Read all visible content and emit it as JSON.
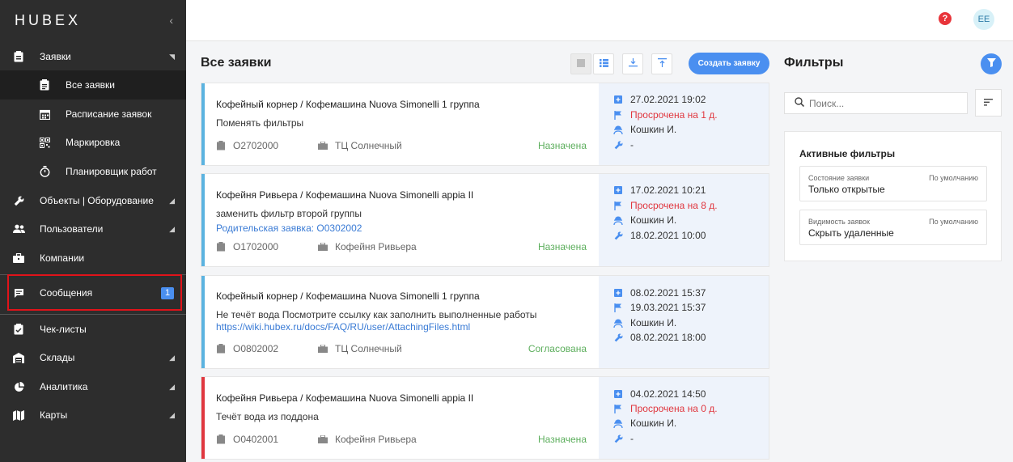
{
  "app": {
    "logo": "HUBEX",
    "collapse_icon": "chevron-left-icon"
  },
  "sidebar": {
    "items": [
      {
        "label": "Заявки",
        "icon": "clipboard-icon",
        "arrow": "◥"
      },
      {
        "label": "Все заявки",
        "icon": "list-clipboard-icon",
        "active": true
      },
      {
        "label": "Расписание заявок",
        "icon": "calendar-icon"
      },
      {
        "label": "Маркировка",
        "icon": "qr-code-icon"
      },
      {
        "label": "Планировщик работ",
        "icon": "stopwatch-icon"
      },
      {
        "label": "Объекты | Оборудование",
        "icon": "wrench-icon",
        "arrow": "◢"
      },
      {
        "label": "Пользователи",
        "icon": "users-icon",
        "arrow": "◢"
      },
      {
        "label": "Компании",
        "icon": "briefcase-icon"
      },
      {
        "label": "Сообщения",
        "icon": "message-icon",
        "badge": "1"
      },
      {
        "label": "Чек-листы",
        "icon": "checklist-icon"
      },
      {
        "label": "Склады",
        "icon": "warehouse-icon",
        "arrow": "◢"
      },
      {
        "label": "Аналитика",
        "icon": "pie-chart-icon",
        "arrow": "◢"
      },
      {
        "label": "Карты",
        "icon": "map-icon",
        "arrow": "◢"
      }
    ]
  },
  "topbar": {
    "help": "?",
    "avatar": "EE"
  },
  "main": {
    "title": "Все заявки",
    "create_label": "Создать заявку"
  },
  "tickets": [
    {
      "title": "Кофейный корнер / Кофемашина Nuova Simonelli 1 группа",
      "description": "Поменять фильтры",
      "link": "",
      "number": "O2702000",
      "location": "ТЦ Солнечный",
      "status": "Назначена",
      "stripe": "#5bb3e0",
      "created": "27.02.2021 19:02",
      "deadline": "Просрочена на 1 д.",
      "deadline_overdue": true,
      "assignee": "Кошкин И.",
      "planned": "-"
    },
    {
      "title": "Кофейня Ривьера / Кофемашина Nuova Simonelli appia II",
      "description": "заменить фильтр второй группы",
      "link": "Родительская заявка: O0302002",
      "number": "O1702000",
      "location": "Кофейня Ривьера",
      "status": "Назначена",
      "stripe": "#5bb3e0",
      "created": "17.02.2021 10:21",
      "deadline": "Просрочена на 8 д.",
      "deadline_overdue": true,
      "assignee": "Кошкин И.",
      "planned": "18.02.2021 10:00"
    },
    {
      "title": "Кофейный корнер / Кофемашина Nuova Simonelli 1 группа",
      "description": "Не течёт вода Посмотрите ссылку как заполнить выполненные работы",
      "link": "https://wiki.hubex.ru/docs/FAQ/RU/user/AttachingFiles.html",
      "number": "O0802002",
      "location": "ТЦ Солнечный",
      "status": "Согласована",
      "stripe": "#5bb3e0",
      "created": "08.02.2021 15:37",
      "deadline": "19.03.2021 15:37",
      "deadline_overdue": false,
      "assignee": "Кошкин И.",
      "planned": "08.02.2021 18:00"
    },
    {
      "title": "Кофейня Ривьера / Кофемашина Nuova Simonelli appia II",
      "description": "Течёт вода из поддона",
      "link": "",
      "number": "O0402001",
      "location": "Кофейня Ривьера",
      "status": "Назначена",
      "stripe": "#e0373f",
      "created": "04.02.2021 14:50",
      "deadline": "Просрочена на 0 д.",
      "deadline_overdue": true,
      "assignee": "Кошкин И.",
      "planned": "-"
    }
  ],
  "filters": {
    "title": "Фильтры",
    "search_placeholder": "Поиск...",
    "active_header": "Активные фильтры",
    "items": [
      {
        "label": "Состояние заявки",
        "default": "По умолчанию",
        "value": "Только открытые"
      },
      {
        "label": "Видимость заявок",
        "default": "По умолчанию",
        "value": "Скрыть удаленные"
      }
    ]
  },
  "colors": {
    "accent": "#4a8ff0",
    "sidebar": "#2d2d2d",
    "status_green": "#5cae5c",
    "overdue_red": "#e0373f"
  }
}
